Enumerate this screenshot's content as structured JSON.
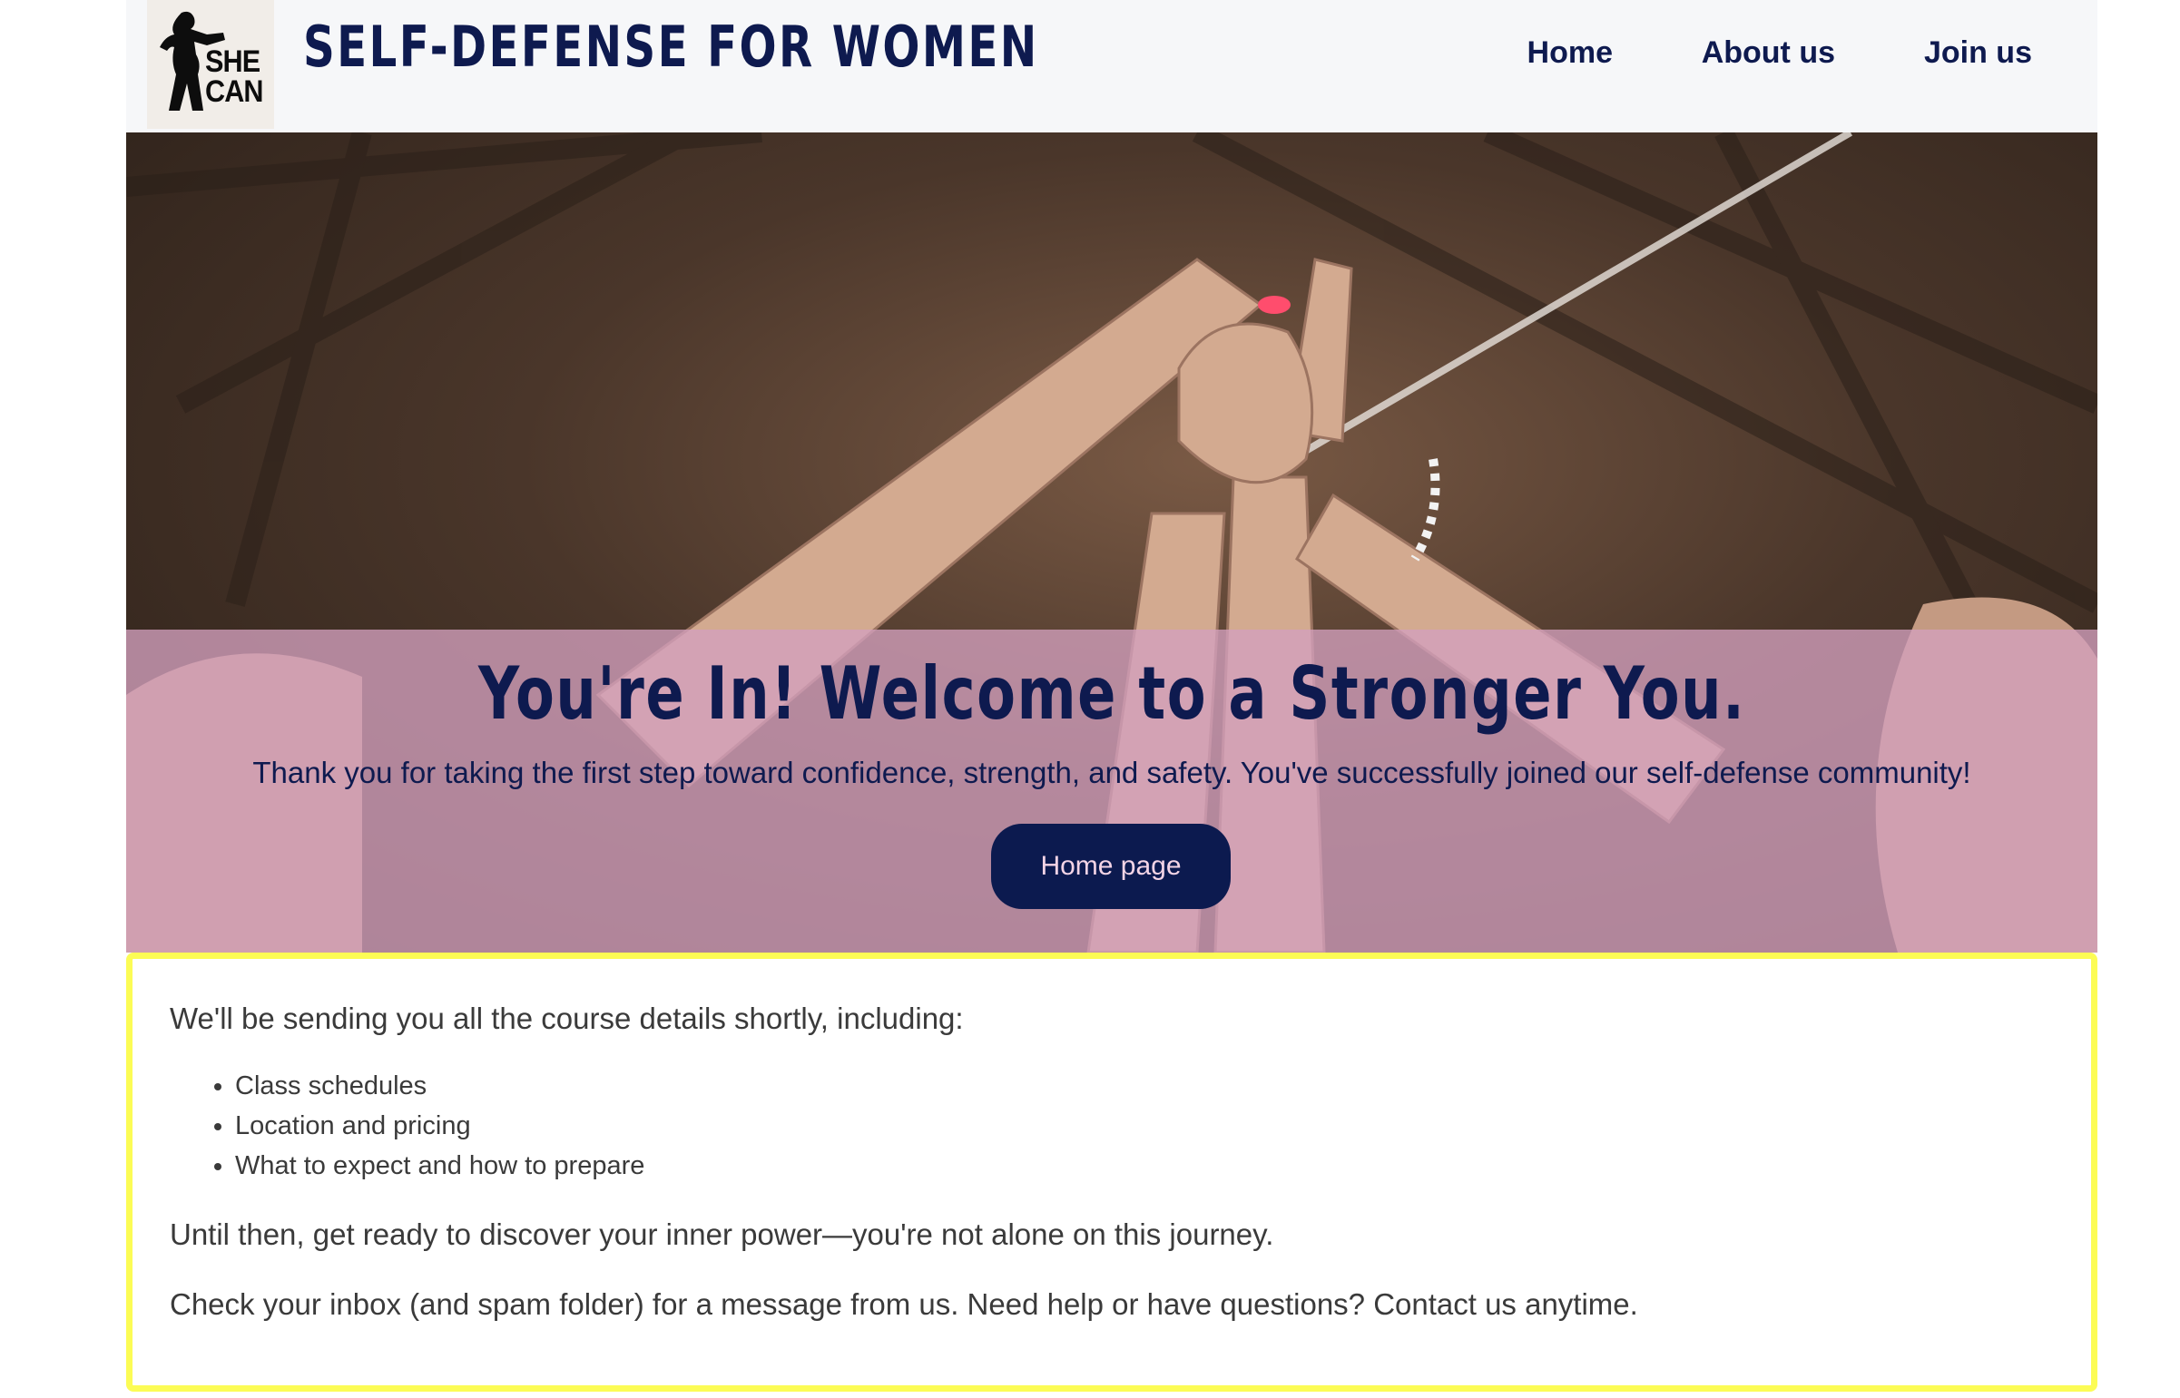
{
  "header": {
    "logo_text_line1": "SHE",
    "logo_text_line2": "CAN",
    "site_title": "SELF-DEFENSE FOR WOMEN",
    "nav": [
      {
        "label": "Home"
      },
      {
        "label": "About us"
      },
      {
        "label": "Join us"
      }
    ]
  },
  "hero": {
    "heading": "You're In! Welcome to a Stronger You.",
    "subtext": "Thank you for taking the first step toward confidence, strength, and safety. You've successfully joined our self-defense community!",
    "button_label": "Home page"
  },
  "info": {
    "intro": "We'll be sending you all the course details shortly, including:",
    "items": [
      "Class schedules",
      "Location and pricing",
      "What to expect and how to prepare"
    ],
    "paragraph2": "Until then, get ready to discover your inner power—you're not alone on this journey.",
    "paragraph3": "Check your inbox (and spam folder) for a message from us. Need help or have questions? Contact us anytime."
  },
  "colors": {
    "brand_navy": "#0e1a4f",
    "header_bg": "#f6f7f9",
    "overlay_pink": "#d4a0be",
    "highlight_border": "#fcfc55",
    "button_text": "#f3d4e6"
  },
  "icons": {
    "logo": "boxer-silhouette-icon"
  }
}
